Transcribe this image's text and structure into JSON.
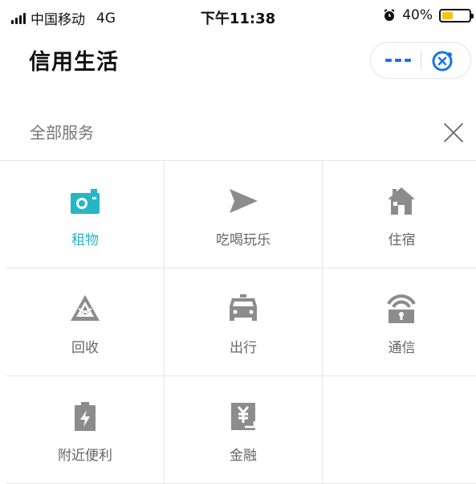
{
  "status_bar": {
    "carrier": "中国移动",
    "network": "4G",
    "time": "下午11:38",
    "battery": "40%",
    "battery_level": 0.4,
    "alarm_icon": "alarm-clock-icon"
  },
  "header": {
    "title": "信用生活",
    "more_icon": "more-dots-icon",
    "close_icon": "close-circle-icon"
  },
  "section": {
    "title": "全部服务",
    "close_icon": "close-x-icon"
  },
  "services": [
    {
      "label": "租物",
      "icon": "camera-icon",
      "active": true
    },
    {
      "label": "吃喝玩乐",
      "icon": "send-arrow-icon",
      "active": false
    },
    {
      "label": "住宿",
      "icon": "house-icon",
      "active": false
    },
    {
      "label": "回收",
      "icon": "recycle-triangle-icon",
      "active": false
    },
    {
      "label": "出行",
      "icon": "car-icon",
      "active": false
    },
    {
      "label": "通信",
      "icon": "wifi-lock-icon",
      "active": false
    },
    {
      "label": "附近便利",
      "icon": "battery-charge-icon",
      "active": false
    },
    {
      "label": "金融",
      "icon": "yuan-bill-icon",
      "active": false
    }
  ],
  "colors": {
    "accent": "#27b7c4",
    "icon_gray": "#8c8c8c",
    "capsule_blue": "#1a73e8",
    "battery_yellow": "#f5c518"
  }
}
